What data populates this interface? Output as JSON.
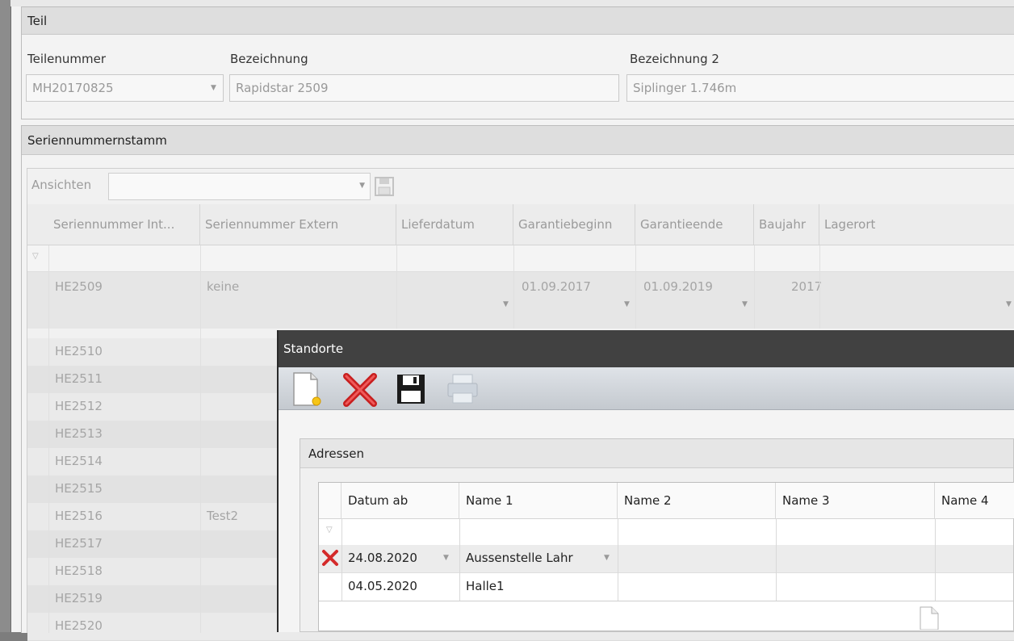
{
  "teil": {
    "header": "Teil",
    "teilenummer_label": "Teilenummer",
    "teilenummer_value": "MH20170825",
    "bezeichnung_label": "Bezeichnung",
    "bezeichnung_value": "Rapidstar 2509",
    "bezeichnung2_label": "Bezeichnung 2",
    "bezeichnung2_value": "Siplinger 1.746m"
  },
  "stamm": {
    "header": "Seriennummernstamm",
    "ansichten_label": "Ansichten",
    "columns": [
      "Seriennummer Int...",
      "Seriennummer Extern",
      "Lieferdatum",
      "Garantiebeginn",
      "Garantieende",
      "Baujahr",
      "Lagerort"
    ],
    "first_row": {
      "intern": "HE2509",
      "extern": "keine",
      "garantiebeginn": "01.09.2017",
      "garantieende": "01.09.2019",
      "baujahr": "2017"
    },
    "rows": [
      {
        "intern": "HE2510",
        "extern": ""
      },
      {
        "intern": "HE2511",
        "extern": ""
      },
      {
        "intern": "HE2512",
        "extern": ""
      },
      {
        "intern": "HE2513",
        "extern": ""
      },
      {
        "intern": "HE2514",
        "extern": ""
      },
      {
        "intern": "HE2515",
        "extern": ""
      },
      {
        "intern": "HE2516",
        "extern": "Test2"
      },
      {
        "intern": "HE2517",
        "extern": ""
      },
      {
        "intern": "HE2518",
        "extern": ""
      },
      {
        "intern": "HE2519",
        "extern": ""
      },
      {
        "intern": "HE2520",
        "extern": ""
      }
    ]
  },
  "modal": {
    "title": "Standorte",
    "toolbar": {
      "new_icon": "new-document-icon",
      "delete_icon": "delete-x-icon",
      "save_icon": "floppy-disk-icon",
      "print_icon": "printer-icon"
    },
    "adressen_header": "Adressen",
    "columns": [
      "Datum ab",
      "Name 1",
      "Name 2",
      "Name 3",
      "Name 4"
    ],
    "rows": [
      {
        "datum": "24.08.2020",
        "name1": "Aussenstelle Lahr",
        "marked_delete": true
      },
      {
        "datum": "04.05.2020",
        "name1": "Halle1",
        "marked_delete": false
      }
    ]
  }
}
